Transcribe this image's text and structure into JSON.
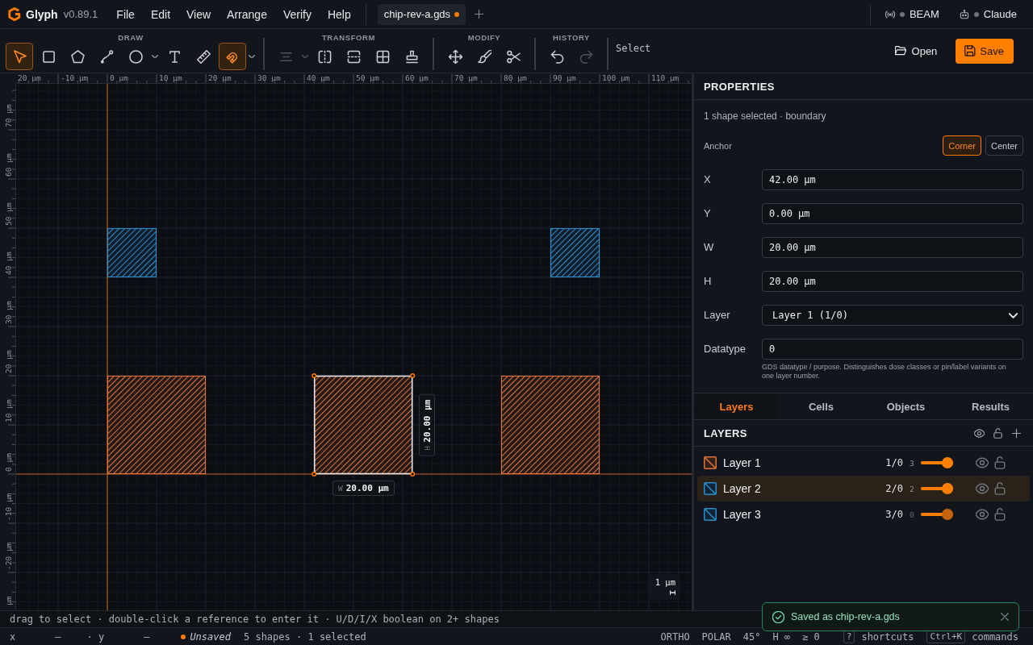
{
  "app": {
    "name": "Glyph",
    "version": "v0.89.1"
  },
  "menu": [
    "File",
    "Edit",
    "View",
    "Arrange",
    "Verify",
    "Help"
  ],
  "document_tabs": [
    {
      "label": "chip-rev-a.gds",
      "selected": true,
      "unsaved": true
    }
  ],
  "connections": [
    {
      "kind": "beam",
      "label": "BEAM",
      "connected": false
    },
    {
      "kind": "assistant",
      "label": "Claude",
      "connected": false
    }
  ],
  "toolbar": {
    "groups": [
      {
        "title": "DRAW",
        "tools": [
          {
            "kind": "select",
            "selected": true,
            "disabled": false
          },
          {
            "kind": "rectangle",
            "selected": false,
            "disabled": false
          },
          {
            "kind": "polygon",
            "selected": false,
            "disabled": false
          },
          {
            "kind": "path",
            "selected": false,
            "disabled": false
          },
          {
            "kind": "circle",
            "selected": false,
            "disabled": false
          },
          {
            "kind": "menu_caret",
            "selected": false,
            "disabled": false
          },
          {
            "kind": "text",
            "selected": false,
            "disabled": false
          },
          {
            "kind": "measure",
            "selected": false,
            "disabled": false
          },
          {
            "kind": "snap",
            "selected": true,
            "disabled": false
          },
          {
            "kind": "menu_caret",
            "selected": false,
            "disabled": false
          }
        ]
      },
      {
        "title": "TRANSFORM",
        "tools": [
          {
            "kind": "align",
            "selected": false,
            "disabled": true
          },
          {
            "kind": "menu_caret",
            "selected": false,
            "disabled": true
          },
          {
            "kind": "flip_horizontal",
            "selected": false,
            "disabled": false
          },
          {
            "kind": "flip_vertical",
            "selected": false,
            "disabled": false
          },
          {
            "kind": "array",
            "selected": false,
            "disabled": false
          },
          {
            "kind": "stamp",
            "selected": false,
            "disabled": false
          }
        ]
      },
      {
        "title": "MODIFY",
        "tools": [
          {
            "kind": "move",
            "selected": false,
            "disabled": false
          },
          {
            "kind": "paint",
            "selected": false,
            "disabled": false
          },
          {
            "kind": "cut",
            "selected": false,
            "disabled": false
          }
        ]
      },
      {
        "title": "HISTORY",
        "tools": [
          {
            "kind": "undo",
            "selected": false,
            "disabled": false
          },
          {
            "kind": "redo",
            "selected": false,
            "disabled": true
          }
        ]
      }
    ],
    "mode": "Select"
  },
  "file_actions": [
    {
      "kind": "open",
      "label": "Open"
    },
    {
      "kind": "save",
      "label": "Save"
    }
  ],
  "canvas": {
    "x_ruler": [
      "20 µm",
      "-10 µm",
      "0 µm",
      "10 µm",
      "20 µm",
      "30 µm",
      "40 µm",
      "50 µm",
      "60 µm",
      "70 µm",
      "80 µm",
      "90 µm",
      "100 µm",
      "110 µm"
    ],
    "y_ruler": [
      "70 µm",
      "60 µm",
      "50 µm",
      "40 µm",
      "30 µm",
      "20 µm",
      "10 µm",
      "0 µm",
      "-10 µm",
      "-20 µm",
      "µm"
    ],
    "shapes": [
      {
        "color": "#2b8fcf",
        "selected": false
      },
      {
        "color": "#2b8fcf",
        "selected": false
      },
      {
        "color": "#e0733a",
        "selected": false
      },
      {
        "color": "#e0733a",
        "selected": true
      },
      {
        "color": "#e0733a",
        "selected": false
      }
    ],
    "width_tag": {
      "prefix": "W",
      "value": "20.00 µm"
    },
    "height_tag": {
      "prefix": "H",
      "value": "20.00 µm"
    },
    "scale": "1 µm"
  },
  "properties": {
    "title": "PROPERTIES",
    "summary": "1 shape selected · boundary",
    "anchor": {
      "label": "Anchor",
      "options": [
        {
          "label": "Corner",
          "selected": true
        },
        {
          "label": "Center",
          "selected": false
        }
      ]
    },
    "fields": [
      {
        "label": "X",
        "kind": "text",
        "value": "42.00 µm"
      },
      {
        "label": "Y",
        "kind": "text",
        "value": "0.00 µm"
      },
      {
        "label": "W",
        "kind": "text",
        "value": "20.00 µm"
      },
      {
        "label": "H",
        "kind": "text",
        "value": "20.00 µm"
      },
      {
        "label": "Layer",
        "kind": "select",
        "value": "Layer 1 (1/0)"
      },
      {
        "label": "Datatype",
        "kind": "text",
        "value": "0",
        "help": "GDS datatype / purpose. Distinguishes dose classes or pin/label variants on one layer number."
      }
    ]
  },
  "panel_tabs": [
    {
      "label": "Layers",
      "selected": true
    },
    {
      "label": "Cells",
      "selected": false
    },
    {
      "label": "Objects",
      "selected": false
    },
    {
      "label": "Results",
      "selected": false
    }
  ],
  "layers_panel": {
    "title": "LAYERS",
    "layers": [
      {
        "name": "Layer 1",
        "code": "1/0",
        "count": "3",
        "color": "#e0733a",
        "selected": false,
        "empty": false,
        "level": 1,
        "visible": true,
        "locked": false
      },
      {
        "name": "Layer 2",
        "code": "2/0",
        "count": "2",
        "color": "#2b8fcf",
        "selected": true,
        "empty": false,
        "level": 1,
        "visible": true,
        "locked": false
      },
      {
        "name": "Layer 3",
        "code": "3/0",
        "count": "0",
        "color": "#2b8fcf",
        "selected": false,
        "empty": true,
        "level": 1,
        "visible": true,
        "locked": false
      }
    ]
  },
  "hint": "drag to select · double-click a reference to enter it · U/D/I/X boolean on 2+ shapes",
  "status_bar": {
    "cursor": [
      {
        "label": "x",
        "value": "—"
      },
      {
        "label": "· y",
        "value": "—"
      }
    ],
    "save_state": {
      "label": "Unsaved",
      "unsaved": true
    },
    "selection": "5 shapes · 1 selected",
    "modes": [
      "ORTHO",
      "POLAR",
      "45°",
      "H ∞",
      "≥ 0"
    ],
    "shortcuts": [
      {
        "key": "?",
        "label": "shortcuts"
      },
      {
        "key": "Ctrl+K",
        "label": "commands"
      }
    ]
  },
  "toast": {
    "kind": "success",
    "message": "Saved as chip-rev-a.gds"
  }
}
